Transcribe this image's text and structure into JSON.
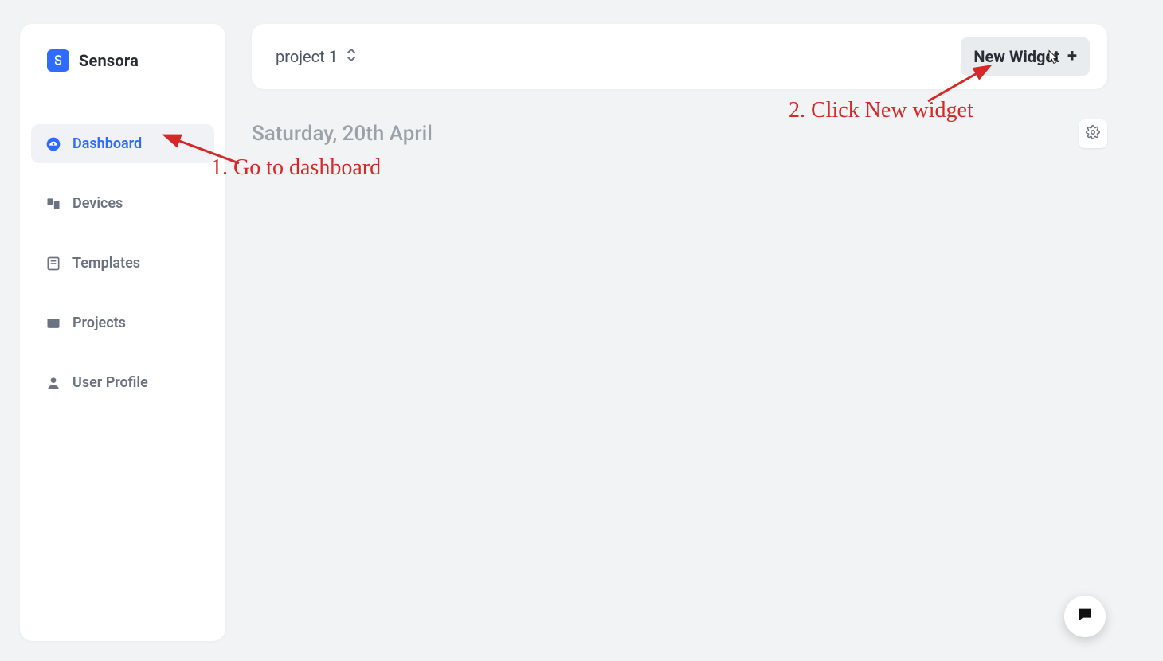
{
  "brand": {
    "name": "Sensora"
  },
  "sidebar": {
    "items": [
      {
        "label": "Dashboard",
        "id": "dashboard"
      },
      {
        "label": "Devices",
        "id": "devices"
      },
      {
        "label": "Templates",
        "id": "templates"
      },
      {
        "label": "Projects",
        "id": "projects"
      },
      {
        "label": "User Profile",
        "id": "user-profile"
      }
    ],
    "active_index": 0
  },
  "header": {
    "project_selector_label": "project 1",
    "new_widget_label": "New Widget"
  },
  "main": {
    "date_label": "Saturday, 20th April"
  },
  "annotations": {
    "step1": "1. Go to dashboard",
    "step2": "2. Click New widget"
  },
  "colors": {
    "brand_blue": "#2f6bff",
    "bg": "#f1f3f5",
    "panel": "#ffffff",
    "text_muted": "#6b7280",
    "annotation_red": "#d62828"
  }
}
